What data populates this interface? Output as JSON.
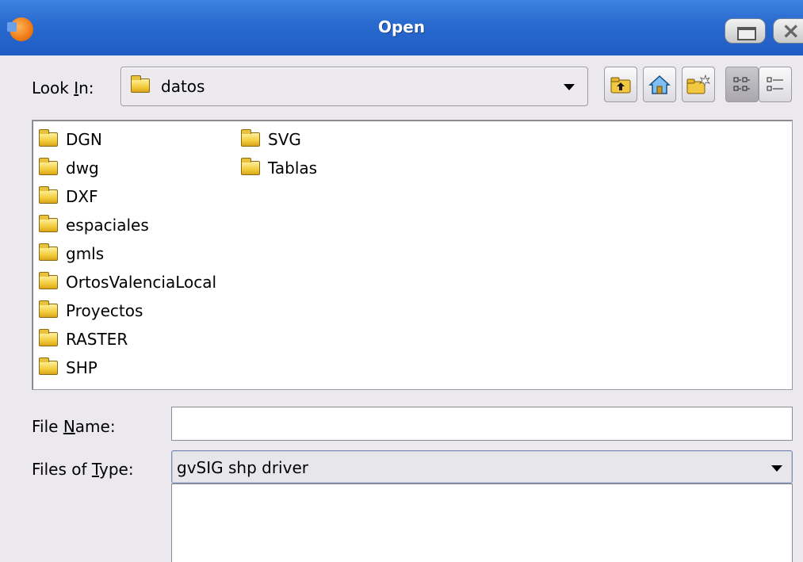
{
  "window": {
    "title": "Open",
    "colors": {
      "titlebar": "#2a6bd0",
      "background": "#ebe9ed"
    }
  },
  "toolbar": {
    "look_in_label_pre": "Look ",
    "look_in_label_mnemonic": "I",
    "look_in_label_post": "n:",
    "look_in_value": "datos",
    "buttons": [
      {
        "name": "up-one-level",
        "icon": "folder-up-icon"
      },
      {
        "name": "home",
        "icon": "home-icon"
      },
      {
        "name": "create-new-folder",
        "icon": "new-folder-icon"
      },
      {
        "name": "list-view",
        "icon": "list-view-icon",
        "selected": true
      },
      {
        "name": "details-view",
        "icon": "details-view-icon"
      }
    ]
  },
  "files": [
    "DGN",
    "dwg",
    "DXF",
    "espaciales",
    "gmls",
    "OrtosValenciaLocal",
    "Proyectos",
    "RASTER",
    "SHP",
    "SVG",
    "Tablas"
  ],
  "form": {
    "file_name_label_pre": "File ",
    "file_name_label_mnemonic": "N",
    "file_name_label_post": "ame:",
    "file_name_value": "",
    "files_of_type_label_pre": "Files of ",
    "files_of_type_label_mnemonic": "T",
    "files_of_type_label_post": "ype:",
    "files_of_type_value": "gvSIG shp driver"
  }
}
